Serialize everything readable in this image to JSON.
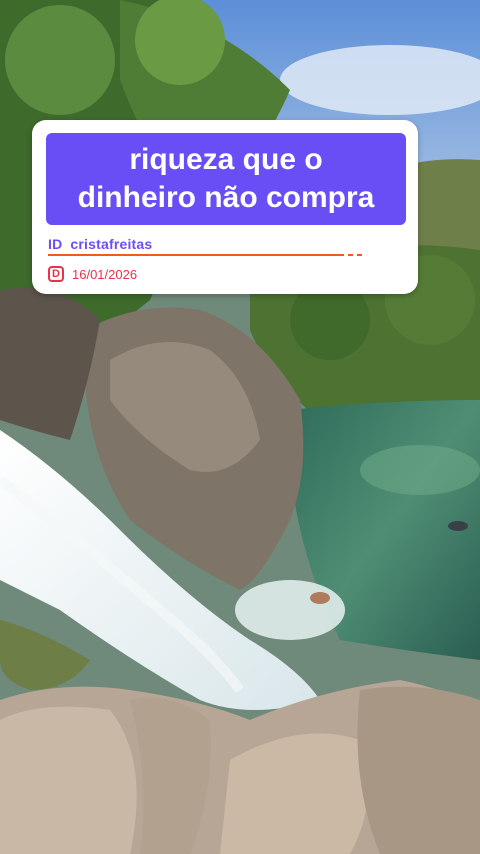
{
  "overlay": {
    "headline": "riqueza que o\ndinheiro não compra",
    "id_prefix": "ID",
    "username": "cristafreitas",
    "date_icon": "D",
    "date": "16/01/2026"
  },
  "colors": {
    "headline_bg": "#6a4ef5",
    "underline": "#f05a1a",
    "date": "#e7334a"
  },
  "icons": [
    "calendar-d-icon"
  ]
}
